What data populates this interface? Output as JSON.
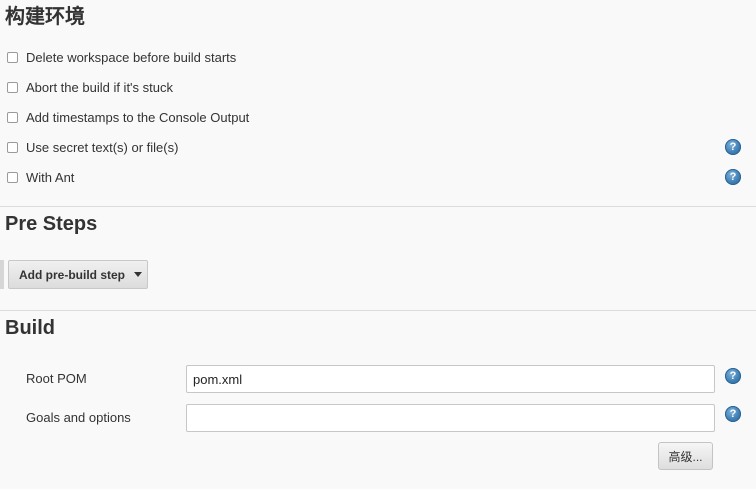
{
  "build_env": {
    "title": "构建环境",
    "options": [
      {
        "label": "Delete workspace before build starts",
        "checked": false,
        "has_help": false
      },
      {
        "label": "Abort the build if it's stuck",
        "checked": false,
        "has_help": false
      },
      {
        "label": "Add timestamps to the Console Output",
        "checked": false,
        "has_help": false
      },
      {
        "label": "Use secret text(s) or file(s)",
        "checked": false,
        "has_help": true
      },
      {
        "label": "With Ant",
        "checked": false,
        "has_help": true
      }
    ]
  },
  "pre_steps": {
    "title": "Pre Steps",
    "add_button_label": "Add pre-build step"
  },
  "build": {
    "title": "Build",
    "root_pom_label": "Root POM",
    "root_pom_value": "pom.xml",
    "goals_label": "Goals and options",
    "goals_value": "",
    "advanced_button_label": "高级..."
  },
  "help_icon_glyph": "?",
  "colors": {
    "help_icon": "#3f7fb5",
    "background": "#f9f9f9"
  }
}
